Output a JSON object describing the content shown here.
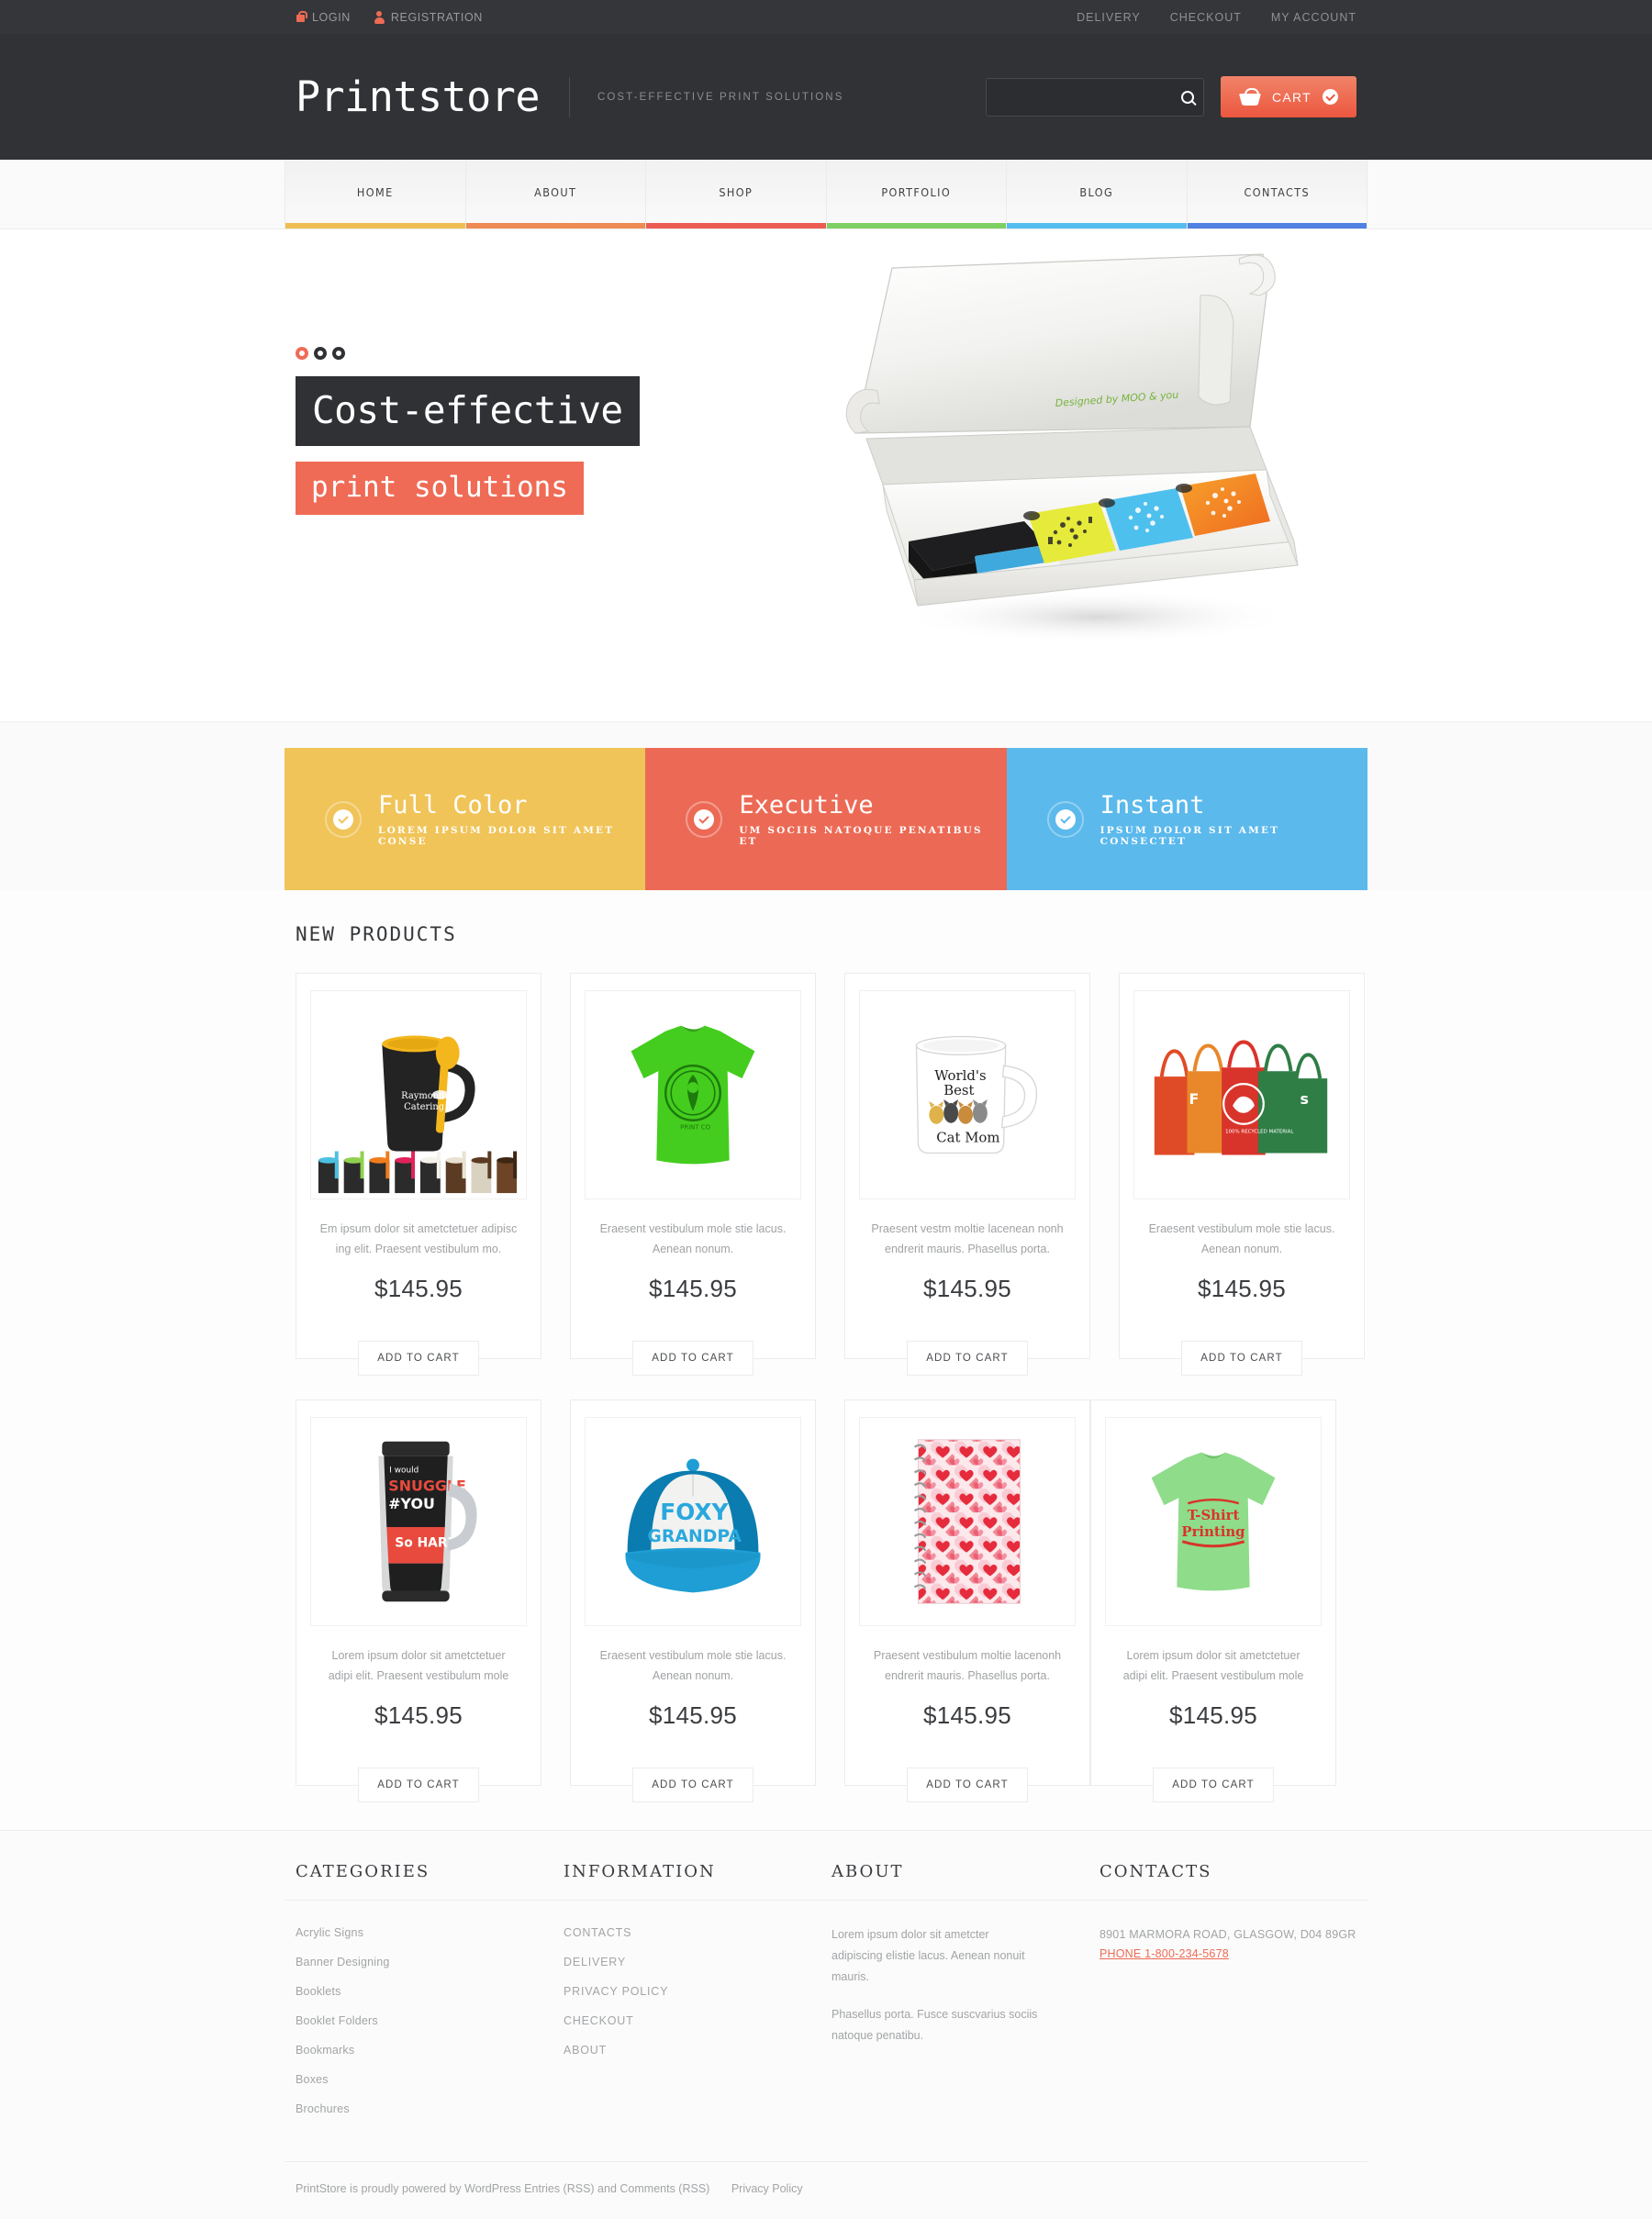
{
  "topbar": {
    "left": [
      {
        "label": "LOGIN",
        "icon": "lock-icon"
      },
      {
        "label": "REGISTRATION",
        "icon": "user-icon"
      }
    ],
    "right": [
      {
        "label": "DELIVERY"
      },
      {
        "label": "CHECKOUT"
      },
      {
        "label": "MY ACCOUNT"
      }
    ]
  },
  "header": {
    "logo": "Printstore",
    "tagline": "COST-EFFECTIVE PRINT SOLUTIONS",
    "search_value": "",
    "search_placeholder": "",
    "search_icon": "search-icon",
    "cart_label": "CART",
    "cart_icon": "basket-icon",
    "cart_check_icon": "check-circle-icon"
  },
  "nav": {
    "items": [
      {
        "label": "HOME",
        "color": "#efbe52"
      },
      {
        "label": "ABOUT",
        "color": "#ed8b52"
      },
      {
        "label": "SHOP",
        "color": "#ec5b52"
      },
      {
        "label": "PORTFOLIO",
        "color": "#7ecf62"
      },
      {
        "label": "BLOG",
        "color": "#54bdf0"
      },
      {
        "label": "CONTACTS",
        "color": "#4f80e2"
      }
    ]
  },
  "hero": {
    "dots": 3,
    "active_dot": 0,
    "title": "Cost-effective",
    "subtitle": "print solutions",
    "image_caption": "Designed by MOO & you"
  },
  "promos": [
    {
      "title": "Full Color",
      "sub": "LOREM IPSUM DOLOR SIT AMET CONSE",
      "color": "#f0c459",
      "icon": "check-circle-icon"
    },
    {
      "title": "Executive",
      "sub": "UM SOCIIS NATOQUE PENATIBUS ET",
      "color": "#ec6a55",
      "icon": "check-circle-icon"
    },
    {
      "title": "Instant",
      "sub": "IPSUM DOLOR SIT AMET CONSECTET",
      "color": "#5bb9ec",
      "icon": "check-circle-icon"
    }
  ],
  "products": {
    "section_title": "NEW PRODUCTS",
    "add_to_cart_label": "ADD TO CART",
    "items": [
      {
        "image": "black-mug-with-yellow-spoon",
        "desc": "Em ipsum dolor sit ametctetuer adipisc ing elit. Praesent vestibulum mo.",
        "price": "$145.95"
      },
      {
        "image": "green-tshirt",
        "desc": "Eraesent vestibulum mole stie lacus. Aenean nonum.",
        "price": "$145.95"
      },
      {
        "image": "worlds-best-cat-mom-mug",
        "desc": "Praesent vestm moltie lacenean nonh endrerit mauris. Phasellus porta.",
        "price": "$145.95"
      },
      {
        "image": "tote-bags",
        "desc": "Eraesent vestibulum mole stie lacus. Aenean nonum.",
        "price": "$145.95"
      },
      {
        "image": "snuggle-travel-mug",
        "desc": "Lorem ipsum dolor sit ametctetuer adipi elit. Praesent vestibulum mole",
        "price": "$145.95"
      },
      {
        "image": "foxy-grandpa-cap",
        "desc": "Eraesent vestibulum mole stie lacus. Aenean nonum.",
        "price": "$145.95"
      },
      {
        "image": "heart-pattern-notebook",
        "desc": "Praesent vestibulum moltie lacenonh endrerit mauris. Phasellus porta.",
        "price": "$145.95"
      },
      {
        "image": "tshirt-printing-green-tee",
        "desc": "Lorem ipsum dolor sit ametctetuer adipi elit. Praesent vestibulum mole",
        "price": "$145.95"
      }
    ]
  },
  "footer": {
    "categories": {
      "heading": "CATEGORIES",
      "items": [
        "Acrylic Signs",
        "Banner Designing",
        "Booklets",
        "Booklet Folders",
        "Bookmarks",
        "Boxes",
        "Brochures"
      ]
    },
    "information": {
      "heading": "INFORMATION",
      "items": [
        "CONTACTS",
        "DELIVERY",
        "PRIVACY POLICY",
        "CHECKOUT",
        "ABOUT"
      ]
    },
    "about": {
      "heading": "ABOUT",
      "p1": "Lorem ipsum dolor sit ametcter adipiscing elistie lacus. Aenean nonuit mauris.",
      "p2": "Phasellus porta. Fusce suscvarius sociis natoque penatibu."
    },
    "contacts": {
      "heading": "CONTACTS",
      "address": "8901 MARMORA ROAD, GLASGOW, D04 89GR",
      "phone": "PHONE 1-800-234-5678",
      "phone_color": "#ee6a54"
    },
    "copyright": "PrintStore is proudly powered by WordPress Entries (RSS) and Comments (RSS)",
    "privacy_link": "Privacy Policy"
  }
}
